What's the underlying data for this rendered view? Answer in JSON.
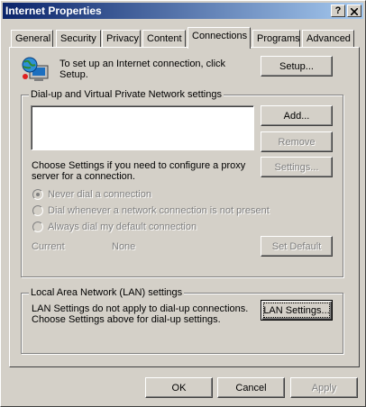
{
  "window": {
    "title": "Internet Properties",
    "help_button": "?",
    "close_button": "X"
  },
  "tabs": [
    {
      "label": "General"
    },
    {
      "label": "Security"
    },
    {
      "label": "Privacy"
    },
    {
      "label": "Content"
    },
    {
      "label": "Connections",
      "active": true
    },
    {
      "label": "Programs"
    },
    {
      "label": "Advanced"
    }
  ],
  "setup": {
    "text_line1": "To set up an Internet connection, click",
    "text_line2": "Setup.",
    "button": "Setup..."
  },
  "dialup": {
    "group_label": "Dial-up and Virtual Private Network settings",
    "add_button": "Add...",
    "remove_button": "Remove",
    "settings_button": "Settings...",
    "hint_line1": "Choose Settings if you need to configure a proxy",
    "hint_line2": "server for a connection.",
    "radio_never": "Never dial a connection",
    "radio_whenever": "Dial whenever a network connection is not present",
    "radio_always": "Always dial my default connection",
    "current_label": "Current",
    "current_value": "None",
    "set_default_button": "Set Default"
  },
  "lan": {
    "group_label": "Local Area Network (LAN) settings",
    "text_line1": "LAN Settings do not apply to dial-up connections.",
    "text_line2": "Choose Settings above for dial-up settings.",
    "button": "LAN Settings..."
  },
  "footer": {
    "ok": "OK",
    "cancel": "Cancel",
    "apply": "Apply"
  },
  "colors": {
    "face": "#d4d0c8",
    "titlebar_start": "#0a246a",
    "titlebar_end": "#a6caf0",
    "disabled_text": "#808080"
  }
}
